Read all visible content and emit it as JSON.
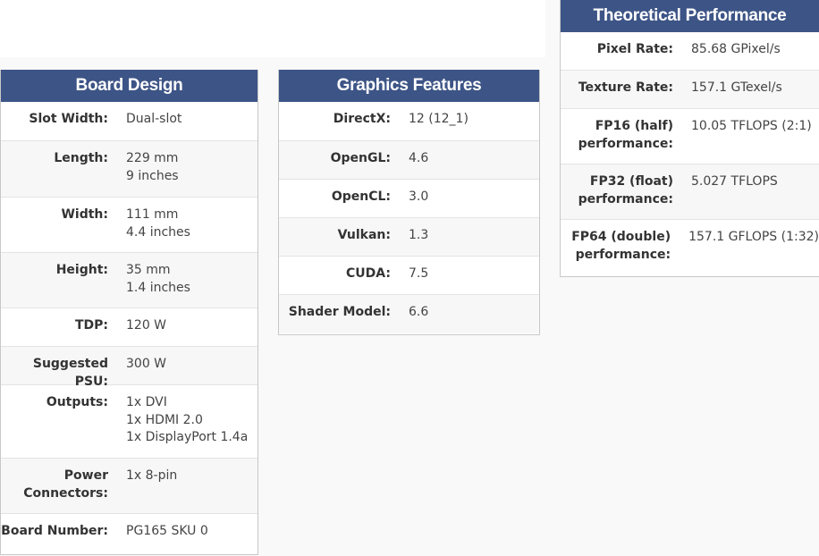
{
  "board_design": {
    "title": "Board Design",
    "rows": [
      {
        "label": "Slot Width:",
        "values": [
          "Dual-slot"
        ]
      },
      {
        "label": "Length:",
        "values": [
          "229 mm",
          "9 inches"
        ]
      },
      {
        "label": "Width:",
        "values": [
          "111 mm",
          "4.4 inches"
        ]
      },
      {
        "label": "Height:",
        "values": [
          "35 mm",
          "1.4 inches"
        ]
      },
      {
        "label": "TDP:",
        "values": [
          "120 W"
        ]
      },
      {
        "label": "Suggested PSU:",
        "values": [
          "300 W"
        ]
      },
      {
        "label": "Outputs:",
        "values": [
          "1x DVI",
          "1x HDMI 2.0",
          "1x DisplayPort 1.4a"
        ]
      },
      {
        "label": "Power Connectors:",
        "values": [
          "1x 8-pin"
        ]
      },
      {
        "label": "Board Number:",
        "values": [
          "PG165 SKU 0"
        ]
      }
    ]
  },
  "graphics_features": {
    "title": "Graphics Features",
    "rows": [
      {
        "label": "DirectX:",
        "values": [
          "12 (12_1)"
        ]
      },
      {
        "label": "OpenGL:",
        "values": [
          "4.6"
        ]
      },
      {
        "label": "OpenCL:",
        "values": [
          "3.0"
        ]
      },
      {
        "label": "Vulkan:",
        "values": [
          "1.3"
        ]
      },
      {
        "label": "CUDA:",
        "values": [
          "7.5"
        ]
      },
      {
        "label": "Shader Model:",
        "values": [
          "6.6"
        ]
      }
    ]
  },
  "theoretical_performance": {
    "title": "Theoretical Performance",
    "rows": [
      {
        "label": "Pixel Rate:",
        "values": [
          "85.68 GPixel/s"
        ]
      },
      {
        "label": "Texture Rate:",
        "values": [
          "157.1 GTexel/s"
        ]
      },
      {
        "label": "FP16 (half) performance:",
        "values": [
          "10.05 TFLOPS (2:1)"
        ]
      },
      {
        "label": "FP32 (float) performance:",
        "values": [
          "5.027 TFLOPS"
        ]
      },
      {
        "label": "FP64 (double) performance:",
        "values": [
          "157.1 GFLOPS (1:32)"
        ]
      }
    ]
  },
  "colors": {
    "header_bg": "#3d5486",
    "header_text": "#ffffff"
  }
}
